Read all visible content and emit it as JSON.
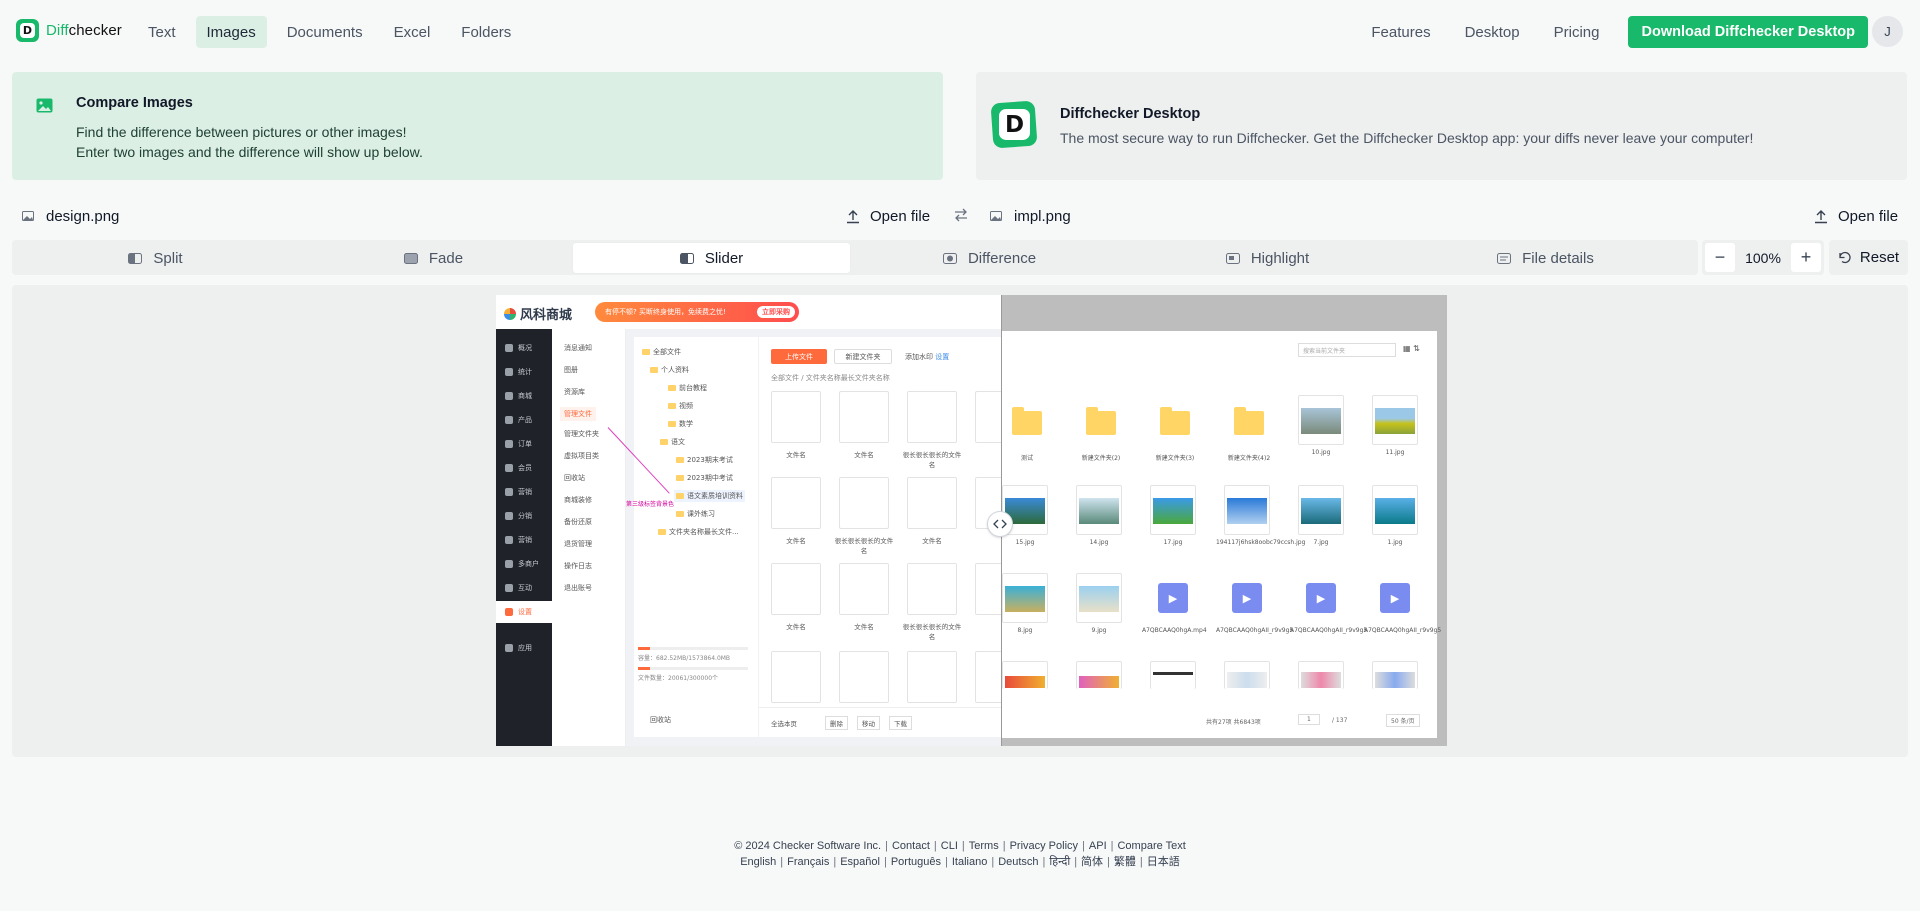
{
  "header": {
    "logo": {
      "prefix": "Diff",
      "suffix": "checker",
      "mark": "D"
    },
    "nav": [
      "Text",
      "Images",
      "Documents",
      "Excel",
      "Folders"
    ],
    "active_nav": "Images",
    "right_nav": [
      "Features",
      "Desktop",
      "Pricing"
    ],
    "download_label": "Download Diffchecker Desktop",
    "avatar_initial": "J"
  },
  "info": {
    "title": "Compare Images",
    "line1": "Find the difference between pictures or other images!",
    "line2": "Enter two images and the difference will show up below."
  },
  "promo": {
    "mark": "D",
    "title": "Diffchecker Desktop",
    "desc": "The most secure way to run Diffchecker. Get the Diffchecker Desktop app: your diffs never leave your computer!"
  },
  "files": {
    "left_name": "design.png",
    "right_name": "impl.png",
    "open_label": "Open file"
  },
  "modes": {
    "items": [
      "Split",
      "Fade",
      "Slider",
      "Difference",
      "Highlight",
      "File details"
    ],
    "active": "Slider"
  },
  "zoom": {
    "value": "100%",
    "minus": "−",
    "plus": "+",
    "reset_label": "Reset"
  },
  "screenshot": {
    "logo": "风科商城",
    "banner": "有停不顿? 买断终身使用，免续费之忧!",
    "banner_btn": "立即采购",
    "dark_nav": [
      "概况",
      "统计",
      "商城",
      "产品",
      "订单",
      "会员",
      "营销",
      "分销",
      "营销",
      "多商户",
      "互动",
      "设置",
      "应用"
    ],
    "menu": [
      "消息通知",
      "图册",
      "资源库",
      "管理文件",
      "管理文件夹",
      "虚拟项目类",
      "回收站",
      "商城装修",
      "备份还原",
      "退货管理",
      "操作日志",
      "退出账号"
    ],
    "tree": [
      "全部文件",
      "个人资料",
      "前台教程",
      "视频",
      "数学",
      "语文",
      "2023期末考试",
      "2023期中考试",
      "语文素质培训资料",
      "课外练习",
      "文件夹名称最长文件..."
    ],
    "upload_btn": "上传文件",
    "newfolder_btn": "新建文件夹",
    "watermark_label": "添加水印",
    "settings_link": "设置",
    "crumb": "全部文件 / 文件夹名称最长文件夹名称",
    "file_labels": [
      "文件名",
      "文件名",
      "很长很长很长的文件名",
      "文件名",
      "文件名",
      "很长很长很长的文件名",
      "文件名",
      "文件名",
      "文件名",
      "很长很长很长的文件名"
    ],
    "annotation": "第三级标签背景色",
    "storage": "容量：682.52MB/1573864.0MB",
    "count": "文件数量：20061/300000个",
    "recycle": "回收站",
    "search_placeholder": "搜索当前文件夹",
    "folders": [
      "测试",
      "新建文件夹(2)",
      "新建文件夹(3)",
      "新建文件夹(4)2"
    ],
    "images_row1": [
      "10.jpg",
      "11.jpg"
    ],
    "images_row2": [
      "15.jpg",
      "14.jpg",
      "17.jpg",
      "194117j6hsk8oobc79ccsh.jpg",
      "7.jpg",
      "1.jpg"
    ],
    "images_row3": [
      "8.jpg",
      "9.jpg",
      "A7QBCAAQ0hgA.mp4",
      "A7QBCAAQ0hgAII_r9v9g5",
      "A7QBCAAQ0hgAII_r9v9g5",
      "A7QBCAAQ0hgAII_r9v9g5"
    ],
    "footer_left": [
      "全选本页",
      "删除",
      "移动",
      "下载"
    ],
    "footer_right": "共有27项  共6843项",
    "page": "1",
    "page_total": "/ 137",
    "per_page": "50 条/页"
  },
  "footer": {
    "copyright": "© 2024 Checker Software Inc.",
    "links": [
      "Contact",
      "CLI",
      "Terms",
      "Privacy Policy",
      "API",
      "Compare Text"
    ],
    "languages": [
      "English",
      "Français",
      "Español",
      "Português",
      "Italiano",
      "Deutsch",
      "हिन्दी",
      "简体",
      "繁體",
      "日本語"
    ]
  },
  "colors": {
    "accent": "#19b96b",
    "info_bg": "#dcefe5",
    "panel_bg": "#eeefef"
  }
}
